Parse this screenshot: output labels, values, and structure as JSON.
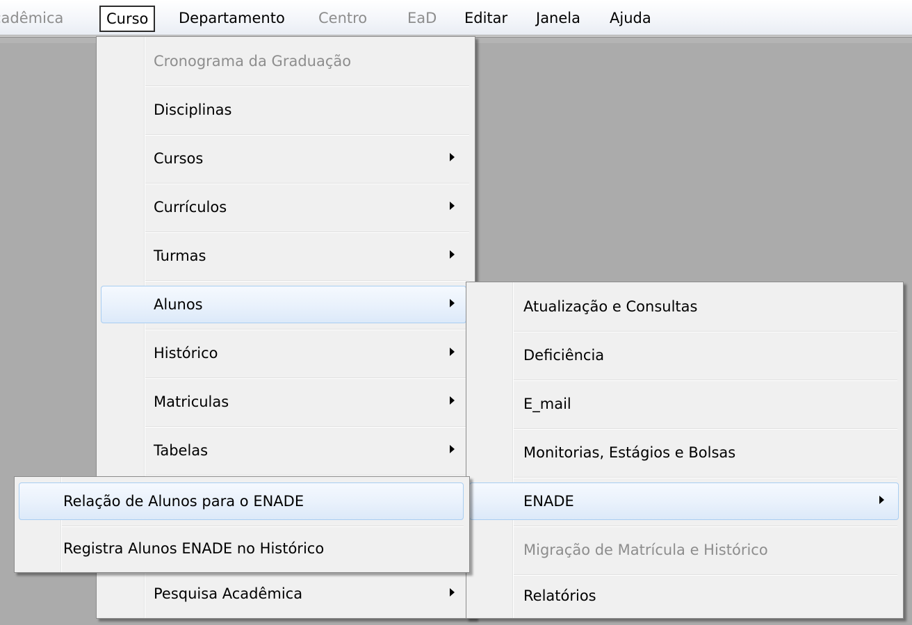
{
  "menubar": {
    "items": [
      {
        "label": "cadêmica",
        "disabled": true
      },
      {
        "label": "Curso",
        "active": true
      },
      {
        "label": "Departamento"
      },
      {
        "label": "Centro",
        "disabled": true
      },
      {
        "label": "EaD",
        "disabled": true
      },
      {
        "label": "Editar"
      },
      {
        "label": "Janela"
      },
      {
        "label": "Ajuda"
      }
    ]
  },
  "curso_menu": {
    "items": [
      {
        "label": "Cronograma da Graduação",
        "disabled": true,
        "submenu": false
      },
      {
        "label": "Disciplinas",
        "submenu": false
      },
      {
        "label": "Cursos",
        "submenu": true
      },
      {
        "label": "Currículos",
        "submenu": true
      },
      {
        "label": "Turmas",
        "submenu": true
      },
      {
        "label": "Alunos",
        "submenu": true,
        "highlighted": true
      },
      {
        "label": "Histórico",
        "submenu": true
      },
      {
        "label": "Matriculas",
        "submenu": true
      },
      {
        "label": "Tabelas",
        "submenu": true
      },
      {
        "label": "Pesquisa Acadêmica",
        "submenu": true
      }
    ]
  },
  "alunos_menu": {
    "items": [
      {
        "label": "Atualização e Consultas"
      },
      {
        "label": "Deficiência"
      },
      {
        "label": "E_mail"
      },
      {
        "label": "Monitorias, Estágios e Bolsas"
      },
      {
        "label": "ENADE",
        "submenu": true,
        "highlighted": true
      },
      {
        "label": "Migração de Matrícula e Histórico",
        "disabled": true
      },
      {
        "label": "Relatórios"
      }
    ]
  },
  "enade_menu": {
    "items": [
      {
        "label": "Relação de Alunos para o ENADE",
        "highlighted": true
      },
      {
        "label": "Registra Alunos ENADE no Histórico"
      }
    ]
  },
  "colors": {
    "background": "#ababab",
    "menu_bg": "#f0f0f0",
    "highlight_border": "#a8cdf1",
    "disabled_text": "#8d8d8d"
  }
}
